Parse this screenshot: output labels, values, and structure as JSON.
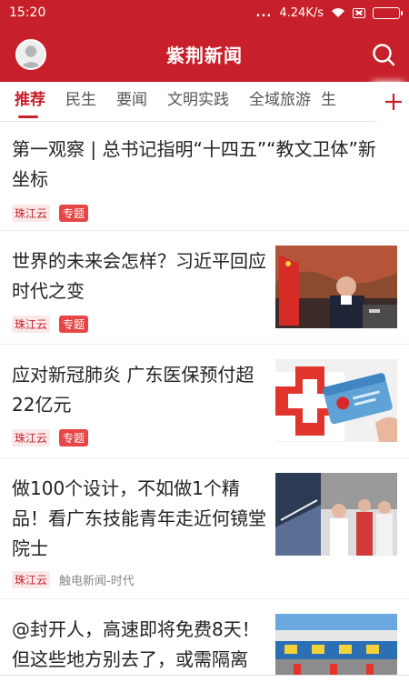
{
  "status_bar": {
    "time": "15:20",
    "signal_dots": "...",
    "net_speed": "4.24K/s"
  },
  "header": {
    "title": "紫荆新闻"
  },
  "tabs": [
    {
      "label": "推荐",
      "active": true
    },
    {
      "label": "民生",
      "active": false
    },
    {
      "label": "要闻",
      "active": false
    },
    {
      "label": "文明实践",
      "active": false
    },
    {
      "label": "全域旅游",
      "active": false
    },
    {
      "label": "生",
      "active": false
    }
  ],
  "feed": [
    {
      "title": "第一观察 | 总书记指明“十四五”“教文卫体”新坐标",
      "source": "珠江云",
      "tag": "专题"
    },
    {
      "title": "世界的未来会怎样？习近平回应时代之变",
      "source": "珠江云",
      "tag": "专题",
      "thumb_label": "主讲人画面"
    },
    {
      "title": "应对新冠肺炎 广东医保预付超22亿元",
      "source": "珠江云",
      "tag": "专题"
    },
    {
      "title": "做100个设计，不如做1个精品！看广东技能青年走近何镜堂院士",
      "source": "珠江云",
      "source2": "触电新闻-时代"
    },
    {
      "title": "@封开人，高速即将免费8天！但这些地方别去了，或需隔离"
    }
  ],
  "colors": {
    "brand_red": "#c8202a",
    "tag_red": "#e64646"
  }
}
